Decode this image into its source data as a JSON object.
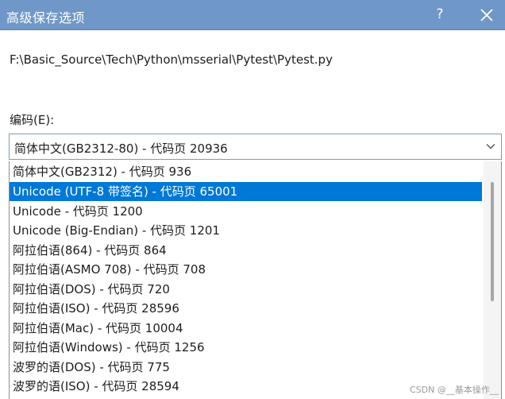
{
  "dialog": {
    "title": "高级保存选项",
    "help_label": "?",
    "file_path": "F:\\Basic_Source\\Tech\\Python\\msserial\\Pytest\\Pytest.py",
    "encoding_label": "编码(E):",
    "selected_encoding": "简体中文(GB2312-80) - 代码页 20936",
    "options": [
      {
        "label": "简体中文(GB2312) - 代码页 936"
      },
      {
        "label": "Unicode (UTF-8 带签名) - 代码页 65001"
      },
      {
        "label": "Unicode - 代码页 1200"
      },
      {
        "label": "Unicode (Big-Endian) - 代码页 1201"
      },
      {
        "label": "阿拉伯语(864) - 代码页 864"
      },
      {
        "label": "阿拉伯语(ASMO 708) - 代码页 708"
      },
      {
        "label": "阿拉伯语(DOS) - 代码页 720"
      },
      {
        "label": "阿拉伯语(ISO) - 代码页 28596"
      },
      {
        "label": "阿拉伯语(Mac) - 代码页 10004"
      },
      {
        "label": "阿拉伯语(Windows) - 代码页 1256"
      },
      {
        "label": "波罗的语(DOS) - 代码页 775"
      },
      {
        "label": "波罗的语(ISO) - 代码页 28594"
      }
    ],
    "highlighted_index": 1,
    "watermark": "CSDN @__基本操作__"
  },
  "colors": {
    "titlebar": "#6f98c8",
    "selection": "#0078d7",
    "combo_border": "#7a9bc4"
  }
}
